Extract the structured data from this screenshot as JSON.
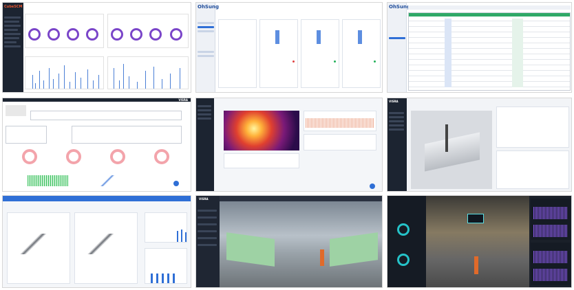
{
  "panels": {
    "p1": {
      "logo": "CubeSCM"
    },
    "p2": {
      "logo": "OhSung"
    },
    "p3": {
      "logo": "OhSung"
    },
    "p4": {
      "logo": "VISRA"
    },
    "p6": {
      "logo": "VISRA"
    },
    "p8": {
      "logo": "VISRA"
    }
  },
  "colors": {
    "purple": "#7a45c9",
    "blue": "#2f6fd6",
    "green": "#22b05a",
    "pink": "#f3a4ab",
    "dark": "#1c2431"
  }
}
